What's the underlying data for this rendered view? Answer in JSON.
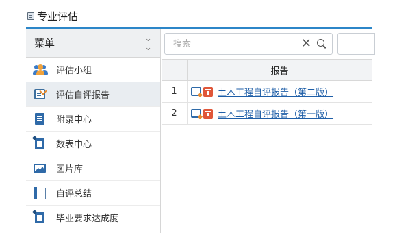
{
  "page": {
    "title": "专业评估",
    "title_icon": "window-icon"
  },
  "sidebar": {
    "header": "菜单",
    "collapse_icon": "double-chevron-down-icon",
    "items": [
      {
        "label": "评估小组",
        "icon": "group-icon",
        "active": false
      },
      {
        "label": "评估自评报告",
        "icon": "report-icon",
        "active": true
      },
      {
        "label": "附录中心",
        "icon": "document-icon",
        "active": false
      },
      {
        "label": "数表中心",
        "icon": "data-table-icon",
        "active": false
      },
      {
        "label": "图片库",
        "icon": "image-icon",
        "active": false
      },
      {
        "label": "自评总结",
        "icon": "book-icon",
        "active": false
      },
      {
        "label": "毕业要求达成度",
        "icon": "document-icon",
        "active": false
      }
    ]
  },
  "search": {
    "placeholder": "搜索",
    "value": "",
    "clear_icon": "close-icon",
    "search_icon": "search-icon"
  },
  "grid": {
    "columns": [
      "",
      "报告"
    ],
    "rows": [
      {
        "index": "1",
        "title": "土木工程自评报告（第二版）"
      },
      {
        "index": "2",
        "title": "土木工程自评报告（第一版）"
      }
    ]
  },
  "colors": {
    "accent": "#2c86c8",
    "link": "#1f5fa8",
    "delete": "#e0573a",
    "sidebar_active": "#e9edf1",
    "header_bg": "#eef0f2"
  }
}
